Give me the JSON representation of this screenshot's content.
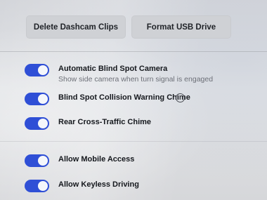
{
  "buttons": {
    "delete_dashcam": "Delete Dashcam Clips",
    "format_usb": "Format USB Drive"
  },
  "settings": [
    {
      "label": "Automatic Blind Spot Camera",
      "description": "Show side camera when turn signal is engaged",
      "enabled": true
    },
    {
      "label": "Blind Spot Collision Warning Chime",
      "enabled": true,
      "info_icon": "info-icon"
    },
    {
      "label": "Rear Cross-Traffic Chime",
      "enabled": true
    },
    {
      "label": "Allow Mobile Access",
      "enabled": true
    },
    {
      "label": "Allow Keyless Driving",
      "enabled": true
    }
  ],
  "colors": {
    "toggle_on": "#2f4fd6",
    "button_bg": "#cfd1d5",
    "text_primary": "#15181d",
    "text_secondary": "#6d7078"
  }
}
